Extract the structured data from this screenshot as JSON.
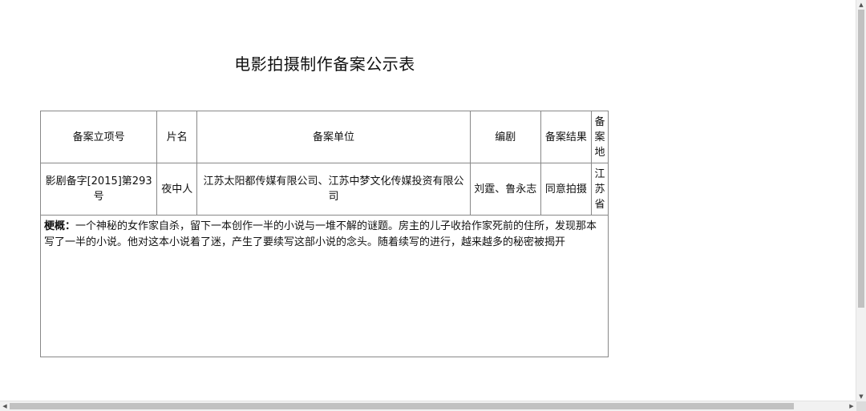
{
  "page": {
    "title": "电影拍摄制作备案公示表"
  },
  "table": {
    "headers": {
      "record_no": "备案立项号",
      "film_name": "片名",
      "unit": "备案单位",
      "screenwriter": "编剧",
      "result": "备案结果",
      "location": "备案地"
    },
    "row": {
      "record_no": "影剧备字[2015]第293号",
      "film_name": "夜中人",
      "unit": "江苏太阳都传媒有限公司、江苏中梦文化传媒投资有限公司",
      "screenwriter": "刘霆、鲁永志",
      "result": "同意拍摄",
      "location": "江苏省"
    },
    "summary": {
      "label": "梗概：",
      "text": "一个神秘的女作家自杀，留下一本创作一半的小说与一堆不解的谜题。房主的儿子收拾作家死前的住所，发现那本写了一半的小说。他对这本小说着了迷，产生了要续写这部小说的念头。随着续写的进行，越来越多的秘密被揭开"
    }
  },
  "scrollbars": {
    "up_arrow": "▲",
    "down_arrow": "▼",
    "left_arrow": "◀",
    "right_arrow": "▶"
  }
}
